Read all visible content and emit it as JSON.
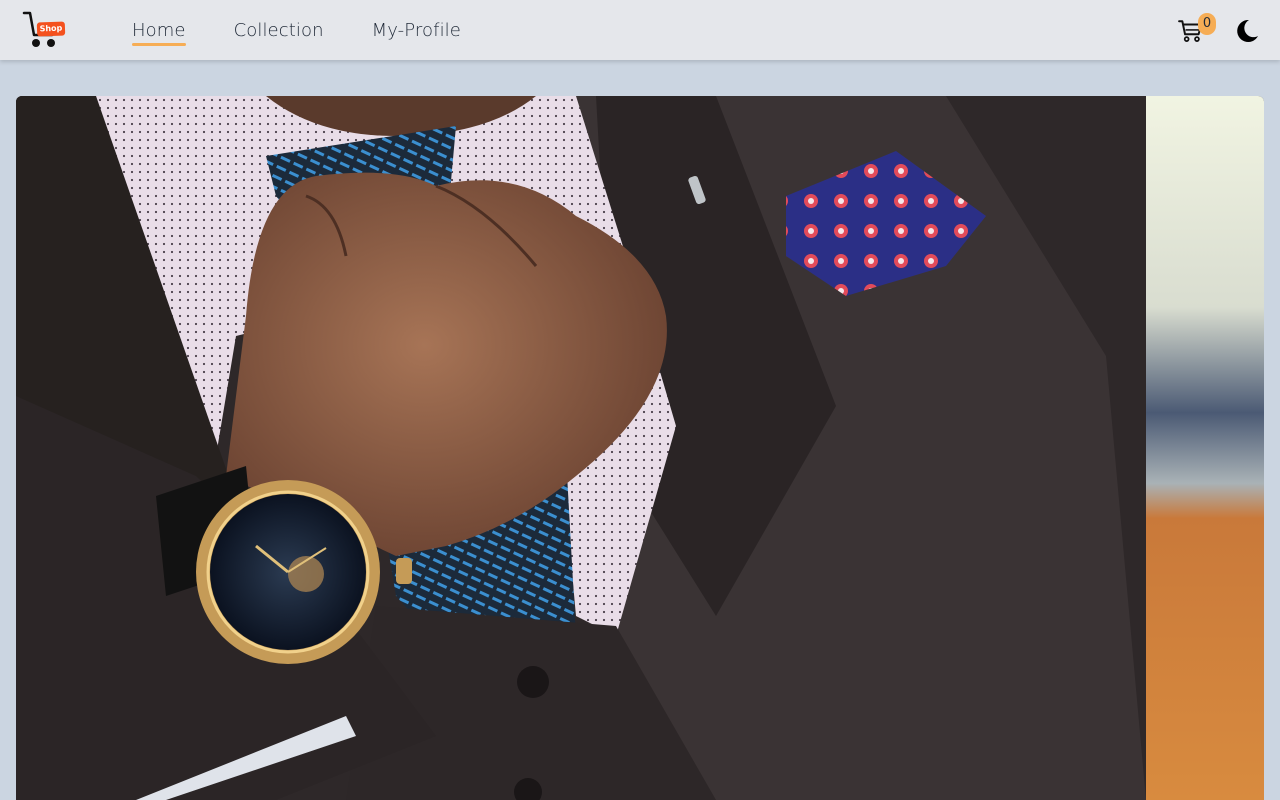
{
  "brand": {
    "logo_icon": "shopping-cart-logo-icon",
    "logo_text": "Shop",
    "accent_color": "#f4511e"
  },
  "nav": {
    "links": [
      {
        "label": "Home",
        "active": true
      },
      {
        "label": "Collection",
        "active": false
      },
      {
        "label": "My-Profile",
        "active": false
      }
    ],
    "active_indicator_color": "#f6ad55"
  },
  "cart": {
    "icon": "cart-icon",
    "count": "0",
    "badge_color": "#f6ad55"
  },
  "theme_toggle": {
    "icon": "moon-icon"
  },
  "hero": {
    "image_subject": "man in dark suit adjusting blue patterned tie, wearing gold wristwatch, blue floral pocket square"
  },
  "colors": {
    "header_bg": "#e5e7eb",
    "page_bg": "#cbd5e1"
  }
}
